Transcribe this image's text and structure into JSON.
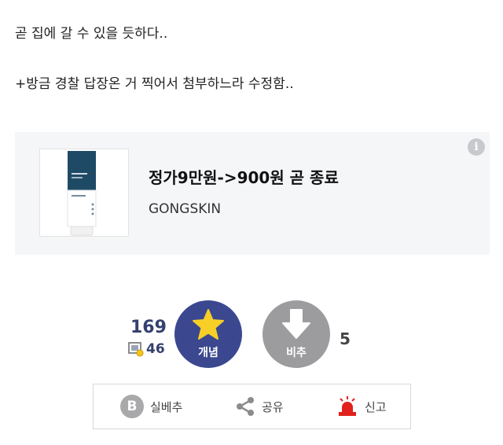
{
  "post": {
    "line1": "곧 집에 갈 수 있을 듯하다..",
    "line2": "+방금 경찰 답장온 거 찍어서 첨부하느라 수정함.."
  },
  "product_card": {
    "title": "정가9만원->900원 곧 종료",
    "brand": "GONGSKIN",
    "info_icon": "i"
  },
  "votes": {
    "up_count": "169",
    "sub_count": "46",
    "up_label": "개념",
    "down_label": "비추",
    "down_count": "5"
  },
  "actions": {
    "best_badge": "B",
    "best_label": "실베추",
    "share_label": "공유",
    "report_label": "신고"
  },
  "colors": {
    "up_button": "#3b4890",
    "down_button": "#9c9c9f",
    "star": "#f7cf26",
    "report": "#e2211c"
  }
}
